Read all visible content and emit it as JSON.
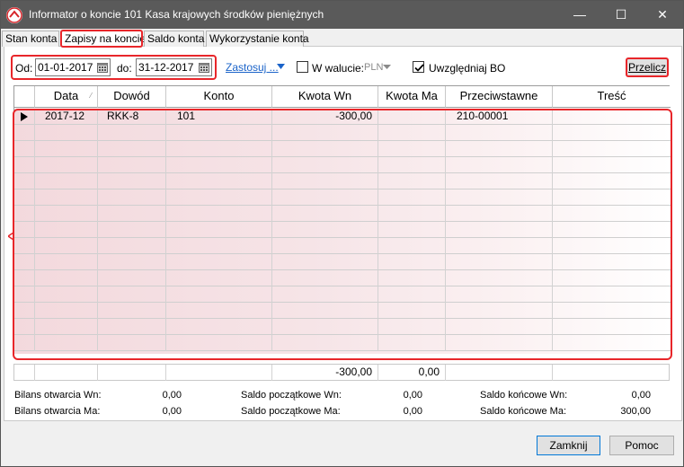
{
  "window": {
    "title": "Informator o koncie 101  Kasa krajowych środków pieniężnych"
  },
  "titlebar_buttons": {
    "minimize": "—",
    "maximize": "☐",
    "close": "✕"
  },
  "tabs": [
    "Stan konta",
    "Zapisy na koncie",
    "Saldo konta",
    "Wykorzystanie konta"
  ],
  "filters": {
    "from_label": "Od:",
    "from_value": "01-01-2017",
    "to_label": "do:",
    "to_value": "31-12-2017",
    "apply_label": "Zastosuj ...",
    "currency_label": "W walucie:",
    "currency_value": "PLN",
    "bo_label": "Uwzględniaj BO",
    "recalc_label": "Przelicz"
  },
  "grid": {
    "columns": [
      "Data",
      "Dowód",
      "Konto",
      "Kwota Wn",
      "Kwota Ma",
      "Przeciwstawne",
      "Treść"
    ],
    "rows": [
      {
        "data": "2017-12",
        "dowod": "RKK-8",
        "konto": "101",
        "kwota_wn": "-300,00",
        "kwota_ma": "",
        "przeciwstawne": "210-00001",
        "tresc": ""
      }
    ],
    "totals": {
      "kwota_wn": "-300,00",
      "kwota_ma": "0,00"
    }
  },
  "summary": {
    "bilans_wn_label": "Bilans otwarcia Wn:",
    "bilans_wn": "0,00",
    "bilans_ma_label": "Bilans otwarcia Ma:",
    "bilans_ma": "0,00",
    "saldo_pocz_wn_label": "Saldo początkowe Wn:",
    "saldo_pocz_wn": "0,00",
    "saldo_pocz_ma_label": "Saldo początkowe Ma:",
    "saldo_pocz_ma": "0,00",
    "saldo_konc_wn_label": "Saldo końcowe Wn:",
    "saldo_konc_wn": "0,00",
    "saldo_konc_ma_label": "Saldo końcowe Ma:",
    "saldo_konc_ma": "300,00"
  },
  "buttons": {
    "close": "Zamknij",
    "help": "Pomoc"
  }
}
